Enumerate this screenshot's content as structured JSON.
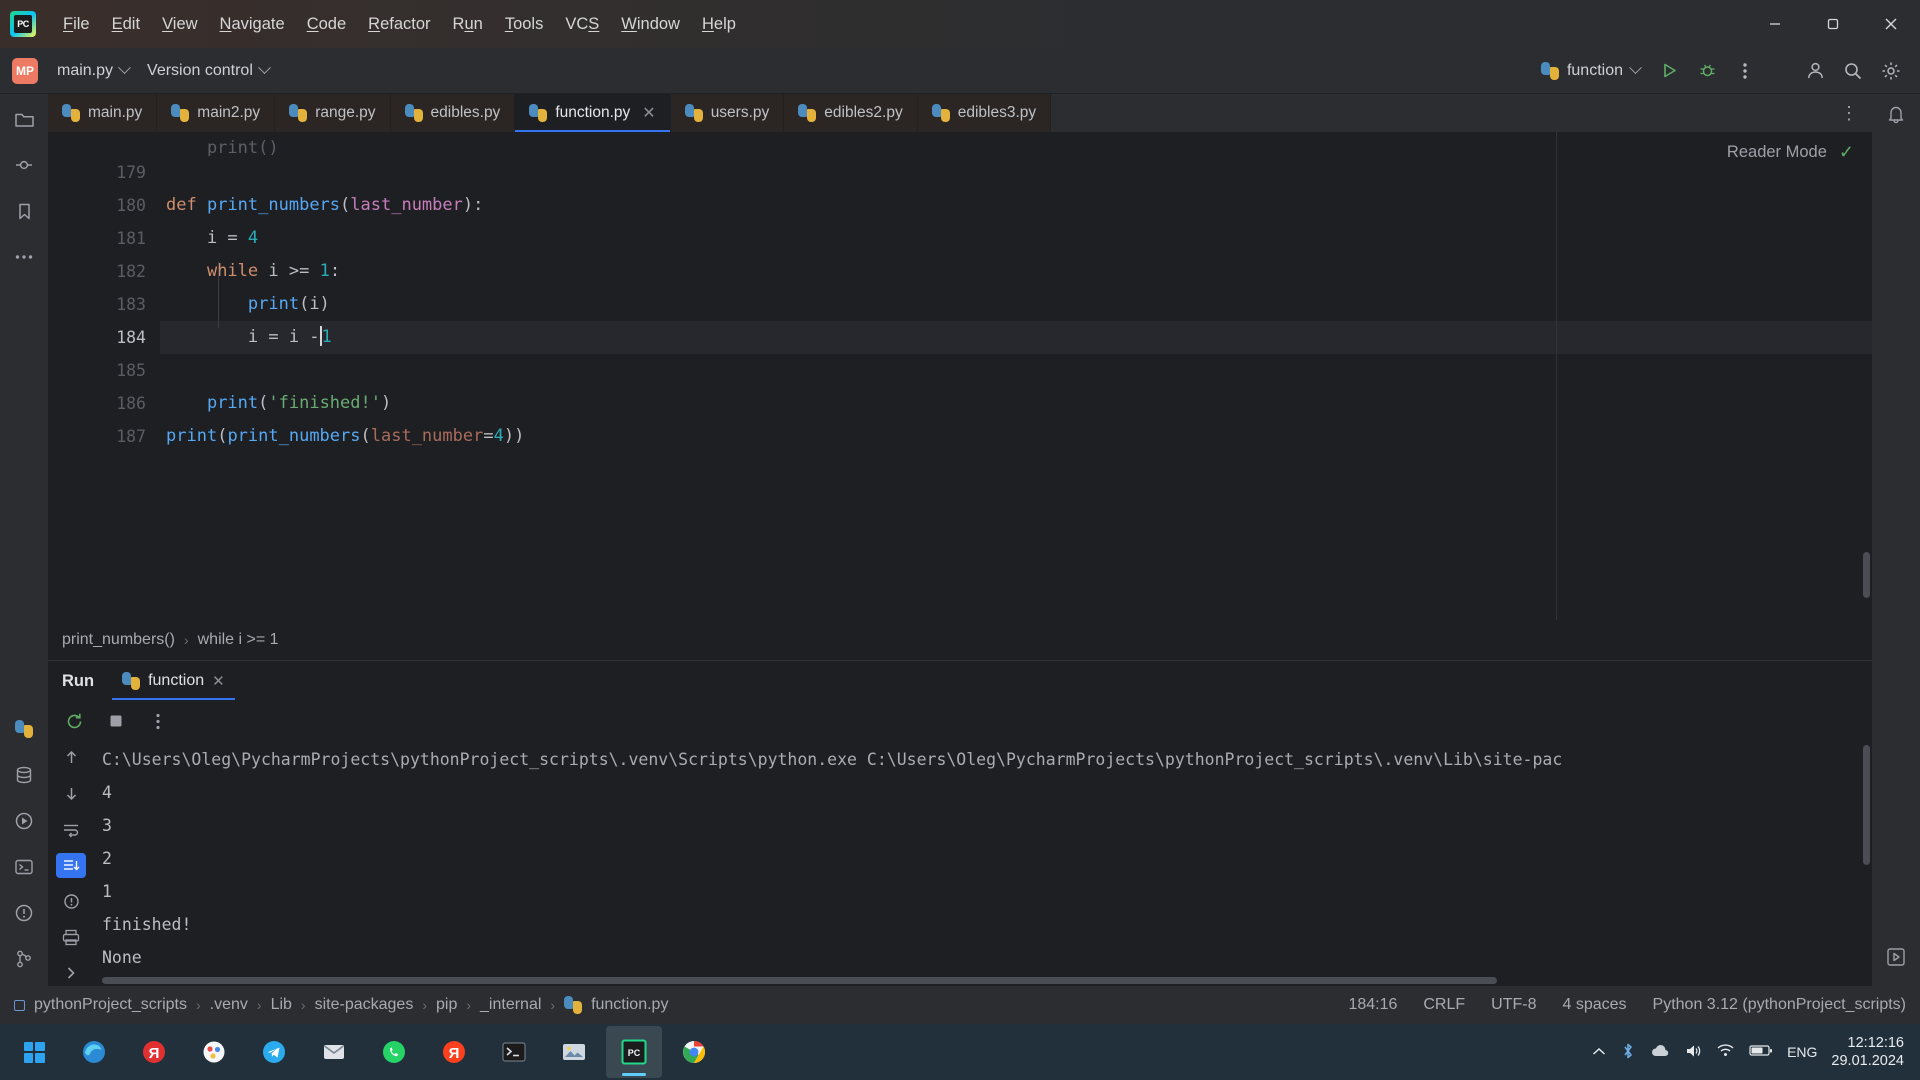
{
  "window": {
    "app_icon_label": "PC",
    "menu_items": [
      {
        "label": "File",
        "mnemonic": "F"
      },
      {
        "label": "Edit",
        "mnemonic": "E"
      },
      {
        "label": "View",
        "mnemonic": "V"
      },
      {
        "label": "Navigate",
        "mnemonic": "N"
      },
      {
        "label": "Code",
        "mnemonic": "C"
      },
      {
        "label": "Refactor",
        "mnemonic": "R"
      },
      {
        "label": "Run",
        "mnemonic": "u"
      },
      {
        "label": "Tools",
        "mnemonic": "T"
      },
      {
        "label": "VCS",
        "mnemonic": "S"
      },
      {
        "label": "Window",
        "mnemonic": "W"
      },
      {
        "label": "Help",
        "mnemonic": "H"
      }
    ],
    "controls": {
      "minimize": "minimize-button",
      "maximize": "maximize-button",
      "close": "close-button"
    }
  },
  "toolbar": {
    "project_badge": "MP",
    "project_name": "main.py",
    "vcs_label": "Version control",
    "run_config": "function",
    "run_icon": "run-icon",
    "debug_icon": "debug-icon",
    "more_icon": "more-actions-icon",
    "account_icon": "account-icon",
    "search_icon": "search-icon",
    "settings_icon": "settings-icon"
  },
  "editor_tabs": [
    {
      "label": "main.py",
      "active": false,
      "closable": false
    },
    {
      "label": "main2.py",
      "active": false,
      "closable": false
    },
    {
      "label": "range.py",
      "active": false,
      "closable": false
    },
    {
      "label": "edibles.py",
      "active": false,
      "closable": false
    },
    {
      "label": "function.py",
      "active": true,
      "closable": true
    },
    {
      "label": "users.py",
      "active": false,
      "closable": false
    },
    {
      "label": "edibles2.py",
      "active": false,
      "closable": false
    },
    {
      "label": "edibles3.py",
      "active": false,
      "closable": false
    }
  ],
  "editor": {
    "reader_mode_label": "Reader Mode",
    "reader_mode_check": "✓",
    "first_visible_line": 179,
    "lines": [
      {
        "num": 179,
        "text": "",
        "current": false
      },
      {
        "num": 180,
        "text": "def print_numbers(last_number):",
        "current": false
      },
      {
        "num": 181,
        "text": "    i = 4",
        "current": false
      },
      {
        "num": 182,
        "text": "    while i >= 1:",
        "current": false
      },
      {
        "num": 183,
        "text": "        print(i)",
        "current": false
      },
      {
        "num": 184,
        "text": "        i = i - 1",
        "current": true
      },
      {
        "num": 185,
        "text": "",
        "current": false
      },
      {
        "num": 186,
        "text": "    print('finished!')",
        "current": false
      },
      {
        "num": 187,
        "text": "print(print_numbers(last_number=4))",
        "current": false
      }
    ],
    "breadcrumb": [
      "print_numbers()",
      "while i >= 1"
    ]
  },
  "run_panel": {
    "title": "Run",
    "tab_label": "function",
    "rerun_icon": "rerun-icon",
    "stop_icon": "stop-icon",
    "more_icon": "more-actions-icon",
    "side_icons": [
      "up-arrow-icon",
      "down-arrow-icon",
      "soft-wrap-icon",
      "scroll-to-end-icon",
      "alert-icon",
      "print-icon",
      "expand-icon"
    ],
    "console_lines": [
      "C:\\Users\\Oleg\\PycharmProjects\\pythonProject_scripts\\.venv\\Scripts\\python.exe C:\\Users\\Oleg\\PycharmProjects\\pythonProject_scripts\\.venv\\Lib\\site-pac",
      "4",
      "3",
      "2",
      "1",
      "finished!",
      "None"
    ]
  },
  "status_bar": {
    "breadcrumb": [
      "pythonProject_scripts",
      ".venv",
      "Lib",
      "site-packages",
      "pip",
      "_internal",
      "function.py"
    ],
    "caret_position": "184:16",
    "line_separator": "CRLF",
    "encoding": "UTF-8",
    "indent": "4 spaces",
    "interpreter": "Python 3.12 (pythonProject_scripts)"
  },
  "taskbar": {
    "start_icon": "windows-start-icon",
    "apps": [
      {
        "name": "edge-icon",
        "active": false
      },
      {
        "name": "yandex-browser-icon",
        "active": false
      },
      {
        "name": "paint-icon",
        "active": false
      },
      {
        "name": "telegram-icon",
        "active": false
      },
      {
        "name": "mail-icon",
        "active": false
      },
      {
        "name": "whatsapp-icon",
        "active": false
      },
      {
        "name": "yandex-icon",
        "active": false
      },
      {
        "name": "terminal-icon",
        "active": false
      },
      {
        "name": "photos-icon",
        "active": false
      },
      {
        "name": "pycharm-icon",
        "active": true
      },
      {
        "name": "chrome-icon",
        "active": false
      }
    ],
    "tray": {
      "chevron": "show-hidden-icons",
      "language": "ENG",
      "time": "12:12:16",
      "date": "29.01.2024"
    }
  },
  "colors": {
    "accent": "#3574f0",
    "run_green": "#5fad65",
    "tab_active_bg": "#1e1f22",
    "panel_bg": "#2b2d30",
    "editor_bg": "#1e1f22",
    "taskbar_bg": "#22303c"
  }
}
